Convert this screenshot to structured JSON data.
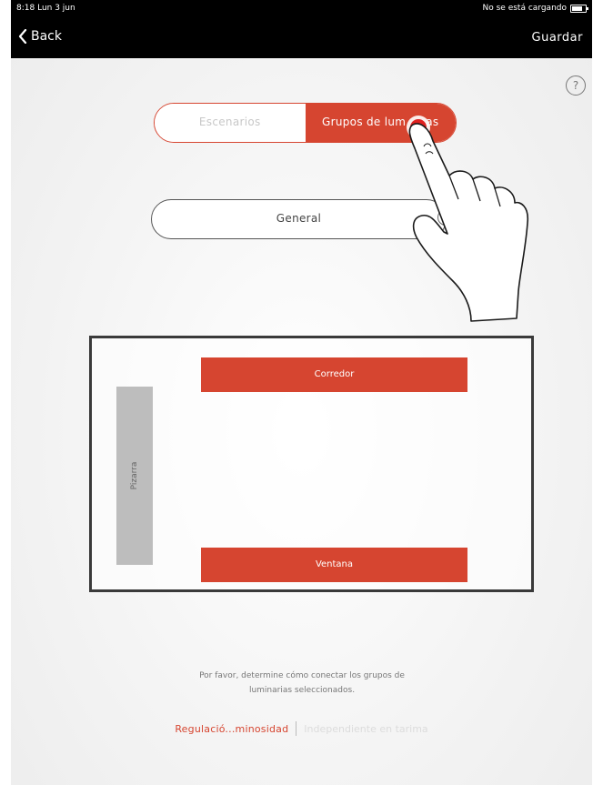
{
  "status_bar": {
    "time": "8:18",
    "date": "Lun 3 jun",
    "battery_status": "No se está cargando"
  },
  "nav": {
    "back_label": "Back",
    "save_label": "Guardar"
  },
  "help": {
    "label": "?"
  },
  "segments": {
    "scenarios": "Escenarios",
    "groups": "Grupos de luminarias",
    "groups_visible": "Grupos de lum",
    "groups_visible_tail": "as",
    "selected": "groups"
  },
  "group_selector": {
    "value": "General"
  },
  "room_plan": {
    "groups": [
      {
        "label": "Corredor"
      },
      {
        "label": "Ventana"
      }
    ],
    "board_label": "Pizarra"
  },
  "instructions": {
    "line1": "Por favor, determine cómo conectar los grupos de",
    "line2": "luminarias seleccionados."
  },
  "modes": {
    "active": "Regulació...minosidad",
    "inactive": "Independiente en tarima"
  },
  "colors": {
    "accent": "#d64530",
    "nav_background": "#000000",
    "board": "#bdbdbd"
  }
}
